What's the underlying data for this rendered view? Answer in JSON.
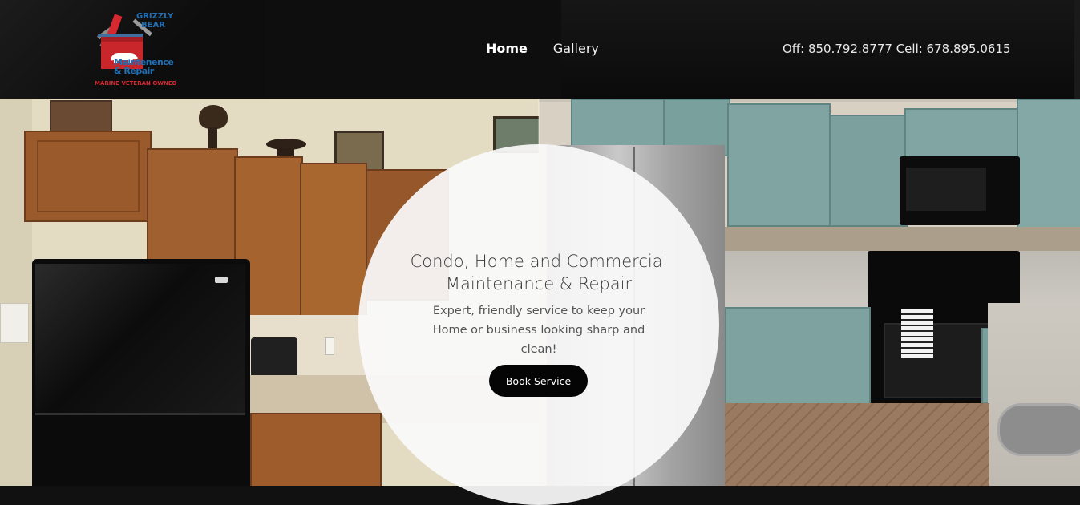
{
  "logo": {
    "line1": "GRIZZLY",
    "line2": "BEAR",
    "line3": "Maintenence",
    "line4": "& Repair",
    "tagline": "MARINE VETERAN OWNED"
  },
  "nav": {
    "items": [
      {
        "label": "Home",
        "active": true
      },
      {
        "label": "Gallery",
        "active": false
      }
    ]
  },
  "contact": {
    "phones": "Off: 850.792.8777 Cell: 678.895.0615"
  },
  "hero": {
    "headline_line1": "Condo, Home and Commercial",
    "headline_line2": "Maintenance & Repair",
    "subtext": "Expert, friendly service to keep your Home or business looking sharp and clean!",
    "cta_label": "Book Service"
  },
  "colors": {
    "header_bg": "#0e0e0e",
    "logo_red": "#d7282f",
    "logo_blue": "#1f6fb5",
    "button_bg": "#050505",
    "cabinet_wood": "#9a5a2e",
    "cabinet_teal": "#7fa3a1"
  }
}
